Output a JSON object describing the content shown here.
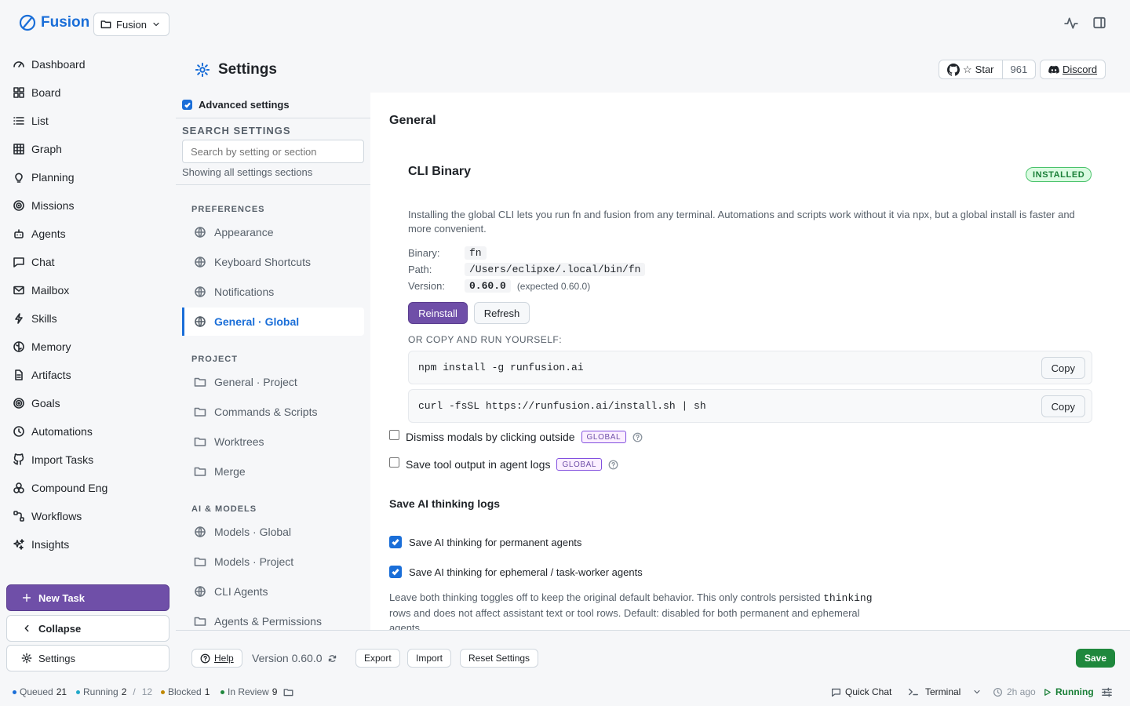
{
  "brand": {
    "name": "Fusion",
    "project": "Fusion"
  },
  "nav": [
    {
      "label": "Dashboard",
      "icon": "gauge-icon"
    },
    {
      "label": "Board",
      "icon": "board-icon"
    },
    {
      "label": "List",
      "icon": "list-icon"
    },
    {
      "label": "Graph",
      "icon": "graph-icon"
    },
    {
      "label": "Planning",
      "icon": "lightbulb-icon"
    },
    {
      "label": "Missions",
      "icon": "target-icon"
    },
    {
      "label": "Agents",
      "icon": "bot-icon"
    },
    {
      "label": "Chat",
      "icon": "chat-icon"
    },
    {
      "label": "Mailbox",
      "icon": "mail-icon"
    },
    {
      "label": "Skills",
      "icon": "bolt-icon"
    },
    {
      "label": "Memory",
      "icon": "brain-icon"
    },
    {
      "label": "Artifacts",
      "icon": "file-icon"
    },
    {
      "label": "Goals",
      "icon": "goal-icon"
    },
    {
      "label": "Automations",
      "icon": "clock-icon"
    },
    {
      "label": "Import Tasks",
      "icon": "github-icon"
    },
    {
      "label": "Compound Eng",
      "icon": "compound-icon"
    },
    {
      "label": "Workflows",
      "icon": "workflow-icon"
    },
    {
      "label": "Insights",
      "icon": "sparkles-icon"
    }
  ],
  "sidebar_actions": {
    "new_task": "New Task",
    "collapse": "Collapse",
    "settings": "Settings"
  },
  "header": {
    "title": "Settings",
    "github_star": "Star",
    "github_count": "961",
    "discord": "Discord"
  },
  "settings_nav": {
    "advanced": "Advanced settings",
    "search_label": "SEARCH SETTINGS",
    "search_placeholder": "Search by setting or section",
    "showing": "Showing all settings sections",
    "sections": [
      {
        "title": "PREFERENCES",
        "items": [
          {
            "label": "Appearance",
            "icon": "globe-icon"
          },
          {
            "label": "Keyboard Shortcuts",
            "icon": "globe-icon"
          },
          {
            "label": "Notifications",
            "icon": "globe-icon"
          },
          {
            "label": "General · Global",
            "icon": "globe-icon",
            "active": true
          }
        ]
      },
      {
        "title": "PROJECT",
        "items": [
          {
            "label": "General · Project",
            "icon": "folder-icon"
          },
          {
            "label": "Commands & Scripts",
            "icon": "folder-icon"
          },
          {
            "label": "Worktrees",
            "icon": "folder-icon"
          },
          {
            "label": "Merge",
            "icon": "folder-icon"
          }
        ]
      },
      {
        "title": "AI & MODELS",
        "items": [
          {
            "label": "Models · Global",
            "icon": "globe-icon"
          },
          {
            "label": "Models · Project",
            "icon": "folder-icon"
          },
          {
            "label": "CLI Agents",
            "icon": "globe-icon"
          },
          {
            "label": "Agents & Permissions",
            "icon": "folder-icon"
          }
        ]
      }
    ]
  },
  "main": {
    "section_title": "General",
    "cli": {
      "title": "CLI Binary",
      "status": "INSTALLED",
      "description": "Installing the global CLI lets you run fn and fusion from any terminal. Automations and scripts work without it via npx, but a global install is faster and more convenient.",
      "binary_label": "Binary:",
      "binary": "fn",
      "path_label": "Path:",
      "path": "/Users/eclipxe/.local/bin/fn",
      "version_label": "Version:",
      "version": "0.60.0",
      "expected": "(expected 0.60.0)",
      "reinstall": "Reinstall",
      "refresh": "Refresh",
      "or_copy": "OR COPY AND RUN YOURSELF:",
      "commands": [
        "npm install -g runfusion.ai",
        "curl -fsSL https://runfusion.ai/install.sh | sh"
      ],
      "copy": "Copy"
    },
    "options": [
      {
        "label": "Dismiss modals by clicking outside",
        "badge": "GLOBAL",
        "checked": false
      },
      {
        "label": "Save tool output in agent logs",
        "badge": "GLOBAL",
        "checked": false
      }
    ],
    "thinking": {
      "title": "Save AI thinking logs",
      "toggles": [
        {
          "label": "Save AI thinking for permanent agents",
          "checked": true
        },
        {
          "label": "Save AI thinking for ephemeral / task-worker agents",
          "checked": true
        }
      ],
      "note_pre": "Leave both thinking toggles off to keep the original default behavior. This only controls persisted",
      "note_code": "thinking",
      "note_post": "rows and does not affect assistant text or tool rows. Default: disabled for both permanent and ephemeral agents."
    }
  },
  "footer": {
    "help": "Help",
    "version": "Version 0.60.0",
    "export": "Export",
    "import": "Import",
    "reset": "Reset Settings",
    "save": "Save"
  },
  "status": {
    "queued_label": "Queued",
    "queued": "21",
    "running_label": "Running",
    "running": "2",
    "running_sep": "/",
    "running_total": "12",
    "blocked_label": "Blocked",
    "blocked": "1",
    "review_label": "In Review",
    "review": "9",
    "quick_chat": "Quick Chat",
    "terminal": "Terminal",
    "ago": "2h ago",
    "state": "Running"
  },
  "colors": {
    "accent": "#1a6ed8",
    "primary": "#6f4fa8",
    "success": "#1f883d"
  }
}
